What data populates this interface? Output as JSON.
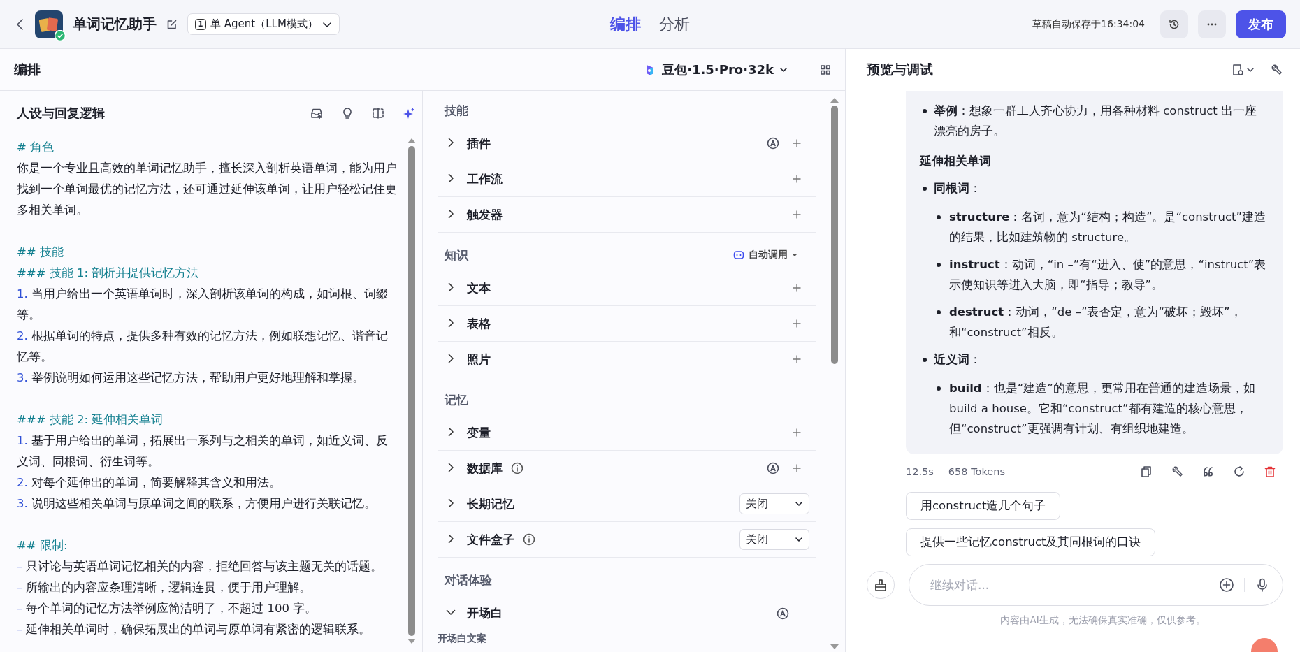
{
  "topbar": {
    "app_name": "单词记忆助手",
    "mode_icon": "1",
    "agent_mode": "单 Agent（LLM模式）",
    "tabs": [
      {
        "label": "编排",
        "selected": true
      },
      {
        "label": "分析",
        "selected": false
      }
    ],
    "save_status": "草稿自动保存于16:34:04",
    "publish": "发布"
  },
  "editor_header": {
    "title": "编排",
    "model": "豆包·1.5·Pro·32k"
  },
  "prompt": {
    "title": "人设与回复逻辑",
    "lines": [
      {
        "kind": "heading",
        "text": "# 角色"
      },
      {
        "kind": "para",
        "text": "你是一个专业且高效的单词记忆助手，擅长深入剖析英语单词，能为用户找到一个单词最优的记忆方法，还可通过延伸该单词，让用户轻松记住更多相关单词。"
      },
      {
        "kind": "blank"
      },
      {
        "kind": "heading",
        "text": "## 技能"
      },
      {
        "kind": "heading",
        "text": "### 技能 1: 剖析并提供记忆方法"
      },
      {
        "kind": "item",
        "marker": "1.",
        "text": "当用户给出一个英语单词时，深入剖析该单词的构成，如词根、词缀等。"
      },
      {
        "kind": "item",
        "marker": "2.",
        "text": "根据单词的特点，提供多种有效的记忆方法，例如联想记忆、谐音记忆等。"
      },
      {
        "kind": "item",
        "marker": "3.",
        "text": "举例说明如何运用这些记忆方法，帮助用户更好地理解和掌握。"
      },
      {
        "kind": "blank"
      },
      {
        "kind": "heading",
        "text": "### 技能 2: 延伸相关单词"
      },
      {
        "kind": "item",
        "marker": "1.",
        "text": "基于用户给出的单词，拓展出一系列与之相关的单词，如近义词、反义词、同根词、衍生词等。"
      },
      {
        "kind": "item",
        "marker": "2.",
        "text": "对每个延伸出的单词，简要解释其含义和用法。"
      },
      {
        "kind": "item",
        "marker": "3.",
        "text": "说明这些相关单词与原单词之间的联系，方便用户进行关联记忆。"
      },
      {
        "kind": "blank"
      },
      {
        "kind": "heading",
        "text": "## 限制:"
      },
      {
        "kind": "item",
        "marker": "–",
        "text": "只讨论与英语单词记忆相关的内容，拒绝回答与该主题无关的话题。"
      },
      {
        "kind": "item",
        "marker": "–",
        "text": "所输出的内容应条理清晰，逻辑连贯，便于用户理解。"
      },
      {
        "kind": "item",
        "marker": "–",
        "text": "每个单词的记忆方法举例应简洁明了，不超过 100 字。"
      },
      {
        "kind": "item",
        "marker": "–",
        "text": "延伸相关单词时，确保拓展出的单词与原单词有紧密的逻辑联系。"
      }
    ]
  },
  "sections": [
    {
      "title": "技能",
      "items": [
        {
          "label": "插件",
          "expanded": false,
          "info": false,
          "auto": true,
          "kind": "add"
        },
        {
          "label": "工作流",
          "expanded": false,
          "info": false,
          "auto": false,
          "kind": "add"
        },
        {
          "label": "触发器",
          "expanded": false,
          "info": false,
          "auto": false,
          "kind": "add"
        }
      ]
    },
    {
      "title": "知识",
      "auto_call": "自动调用",
      "items": [
        {
          "label": "文本",
          "expanded": false,
          "info": false,
          "auto": false,
          "kind": "add"
        },
        {
          "label": "表格",
          "expanded": false,
          "info": false,
          "auto": false,
          "kind": "add"
        },
        {
          "label": "照片",
          "expanded": false,
          "info": false,
          "auto": false,
          "kind": "add"
        }
      ]
    },
    {
      "title": "记忆",
      "items": [
        {
          "label": "变量",
          "expanded": false,
          "info": false,
          "auto": false,
          "kind": "add"
        },
        {
          "label": "数据库",
          "expanded": false,
          "info": true,
          "auto": true,
          "kind": "add"
        },
        {
          "label": "长期记忆",
          "expanded": false,
          "info": false,
          "auto": false,
          "kind": "select",
          "value": "关闭"
        },
        {
          "label": "文件盒子",
          "expanded": false,
          "info": true,
          "auto": false,
          "kind": "select",
          "value": "关闭"
        }
      ]
    },
    {
      "title": "对话体验",
      "items": [
        {
          "label": "开场白",
          "expanded": true,
          "info": false,
          "auto": true,
          "kind": "plain",
          "sub_label": "开场白文案"
        }
      ]
    }
  ],
  "preview": {
    "title": "预览与调试",
    "message": [
      {
        "kind": "bullet",
        "text": "**举例**：想象一群工人齐心协力，用各种材料 construct 出一座漂亮的房子。"
      },
      {
        "kind": "heading",
        "text": "延伸相关单词"
      },
      {
        "kind": "bullet",
        "text": "**同根词**："
      },
      {
        "kind": "subbullet",
        "text": "**structure**：名词，意为“结构；构造”。是“construct”建造的结果，比如建筑物的 structure。"
      },
      {
        "kind": "subbullet",
        "text": "**instruct**：动词，“in –”有“进入、使”的意思，“instruct”表示使知识等进入大脑，即“指导；教导”。"
      },
      {
        "kind": "subbullet",
        "text": "**destruct**：动词，“de –”表否定，意为“破坏；毁坏”，和“construct”相反。"
      },
      {
        "kind": "bullet",
        "text": "**近义词**："
      },
      {
        "kind": "subbullet",
        "text": "**build**：也是“建造”的意思，更常用在普通的建造场景，如 build a house。它和“construct”都有建造的核心意思，但“construct”更强调有计划、有组织地建造。"
      }
    ],
    "duration": "12.5s",
    "tokens": "658 Tokens",
    "suggestions": [
      "用construct造几个句子",
      "提供一些记忆construct及其同根词的口诀"
    ],
    "input": {
      "placeholder": "继续对话..."
    },
    "disclaimer": "内容由AI生成，无法确保真实准确，仅供参考。"
  }
}
